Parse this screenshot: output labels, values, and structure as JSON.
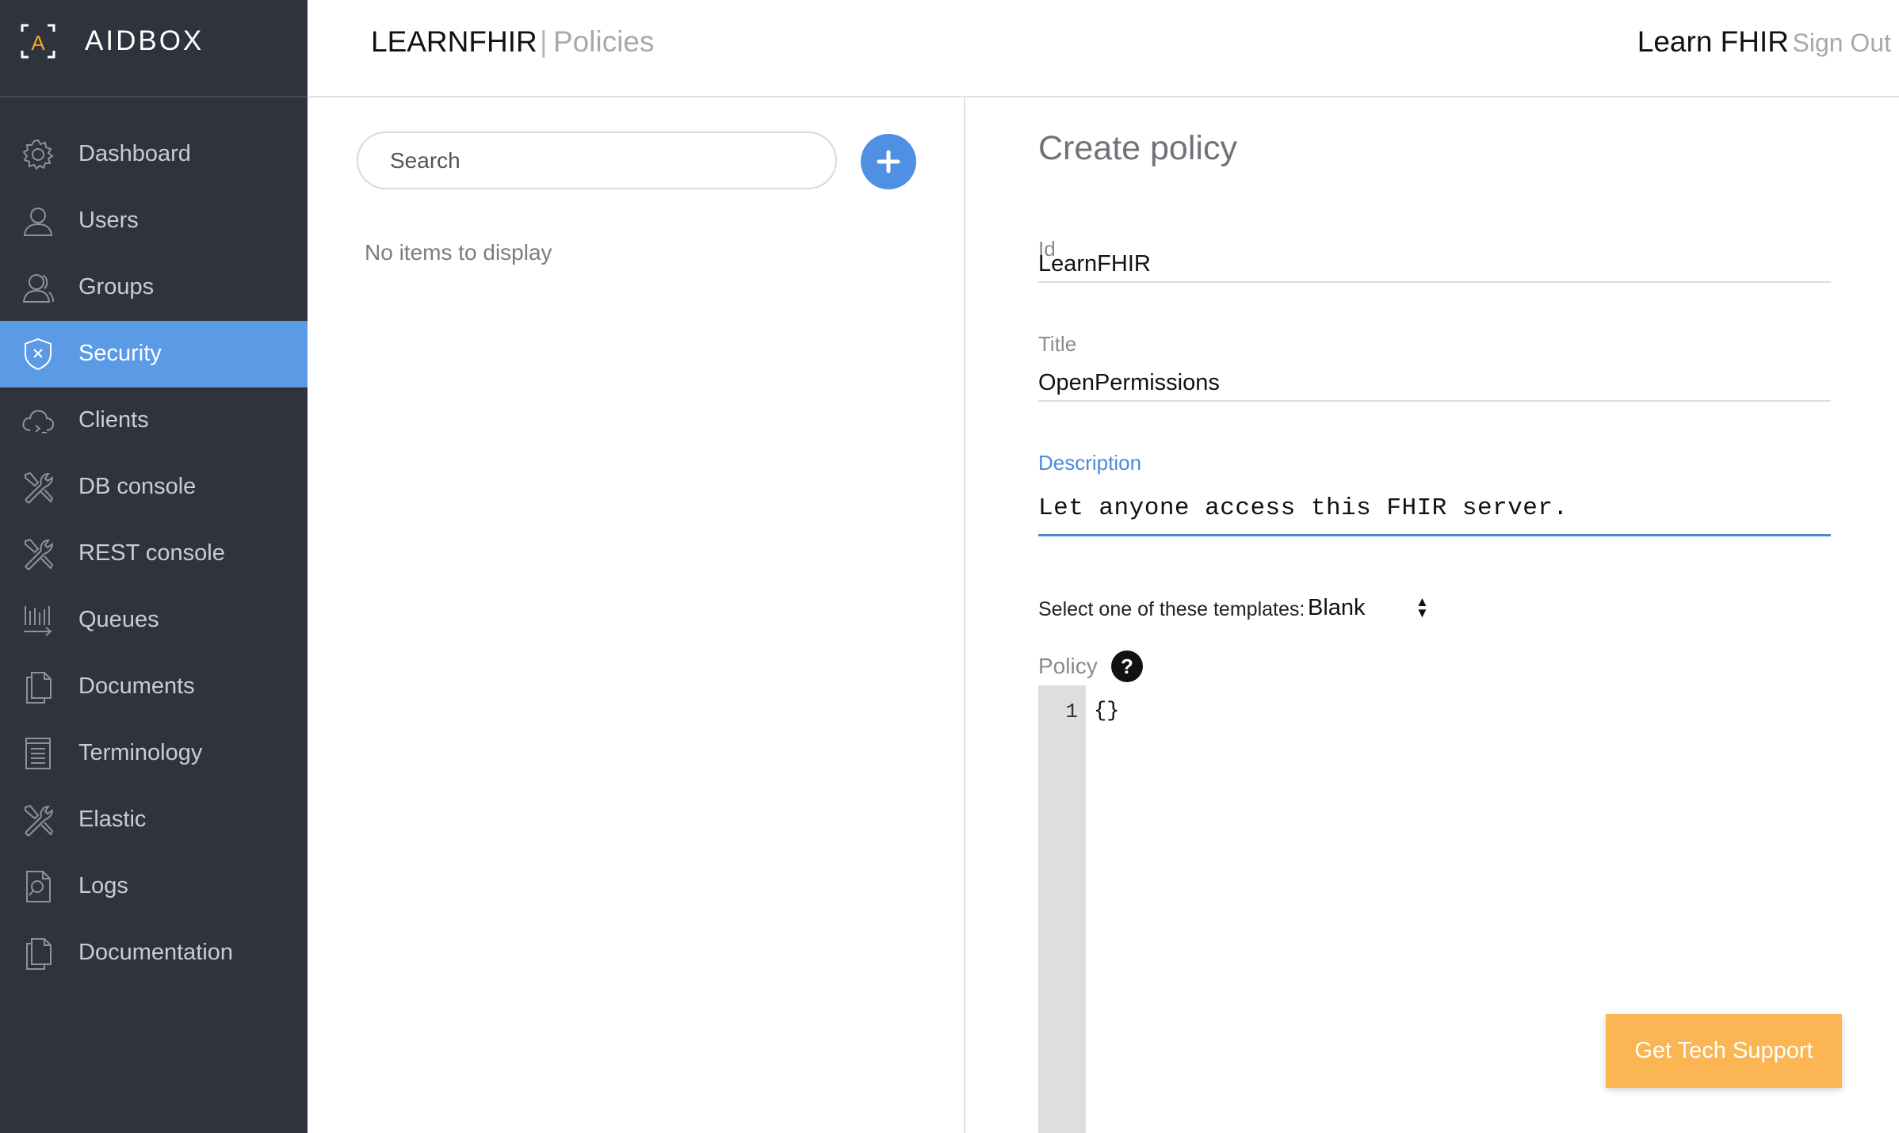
{
  "brand": {
    "name": "AIDBOX",
    "logo_letter": "A",
    "logo_icon": "aidbox-bracket-logo",
    "accent": "#f5a623"
  },
  "sidebar": {
    "items": [
      {
        "label": "Dashboard",
        "icon": "gear-icon"
      },
      {
        "label": "Users",
        "icon": "user-icon"
      },
      {
        "label": "Groups",
        "icon": "user-group-icon"
      },
      {
        "label": "Security",
        "icon": "shield-icon",
        "active": true
      },
      {
        "label": "Clients",
        "icon": "cloud-icon"
      },
      {
        "label": "DB console",
        "icon": "tools-icon"
      },
      {
        "label": "REST console",
        "icon": "tools-icon"
      },
      {
        "label": "Queues",
        "icon": "queue-icon"
      },
      {
        "label": "Documents",
        "icon": "documents-icon"
      },
      {
        "label": "Terminology",
        "icon": "book-icon"
      },
      {
        "label": "Elastic",
        "icon": "tools-icon"
      },
      {
        "label": "Logs",
        "icon": "search-document-icon"
      },
      {
        "label": "Documentation",
        "icon": "documents-icon"
      }
    ],
    "active_color": "#5b9be6",
    "background": "#2f333e"
  },
  "header": {
    "title": "LEARNFHIR",
    "separator": "|",
    "subtitle": "Policies",
    "user": "Learn FHIR",
    "signout": "Sign Out"
  },
  "list": {
    "search_placeholder": "Search",
    "add_icon": "plus-icon",
    "empty_text": "No items to display"
  },
  "form": {
    "title": "Create policy",
    "id": {
      "label": "Id",
      "value": "LearnFHIR"
    },
    "title_field": {
      "label": "Title",
      "value": "OpenPermissions"
    },
    "description": {
      "label": "Description",
      "value": "Let anyone access this FHIR server."
    },
    "template": {
      "label": "Select one of these templates:",
      "value": "Blank"
    },
    "policy": {
      "label": "Policy",
      "help": "?",
      "line_number": "1",
      "code": "{}"
    }
  },
  "support_button": {
    "label": "Get Tech Support",
    "color": "#fbb552"
  }
}
